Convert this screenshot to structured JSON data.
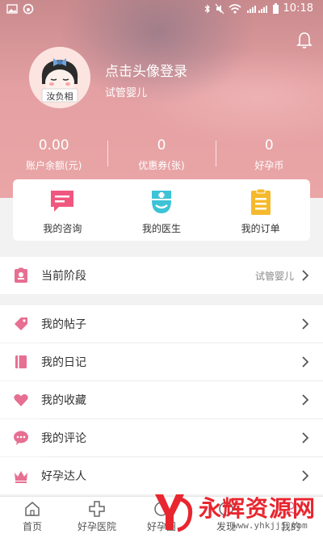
{
  "status_bar": {
    "time": "10:18",
    "net": "4G"
  },
  "profile": {
    "login_prompt": "点击头像登录",
    "stage": "试管婴儿",
    "avatar_caption": "汝负相"
  },
  "stats": [
    {
      "value": "0.00",
      "label": "账户余额(元)"
    },
    {
      "value": "0",
      "label": "优惠券(张)"
    },
    {
      "value": "0",
      "label": "好孕币"
    }
  ],
  "quick_actions": [
    {
      "label": "我的咨询",
      "color": "#f0577f"
    },
    {
      "label": "我的医生",
      "color": "#3cc3d6"
    },
    {
      "label": "我的订单",
      "color": "#f5b92d"
    }
  ],
  "stage_row": {
    "label": "当前阶段",
    "value": "试管婴儿"
  },
  "menu": [
    {
      "label": "我的帖子"
    },
    {
      "label": "我的日记"
    },
    {
      "label": "我的收藏"
    },
    {
      "label": "我的评论"
    },
    {
      "label": "好孕达人"
    }
  ],
  "tabs": [
    {
      "label": "首页"
    },
    {
      "label": "好孕医院"
    },
    {
      "label": "好孕圈"
    },
    {
      "label": "发现"
    },
    {
      "label": "我的"
    }
  ],
  "watermark": {
    "text": "永辉资源网",
    "url": "www.yhkjjj.com"
  },
  "colors": {
    "accent": "#e9a3a5",
    "pink_icon": "#e66f92"
  }
}
